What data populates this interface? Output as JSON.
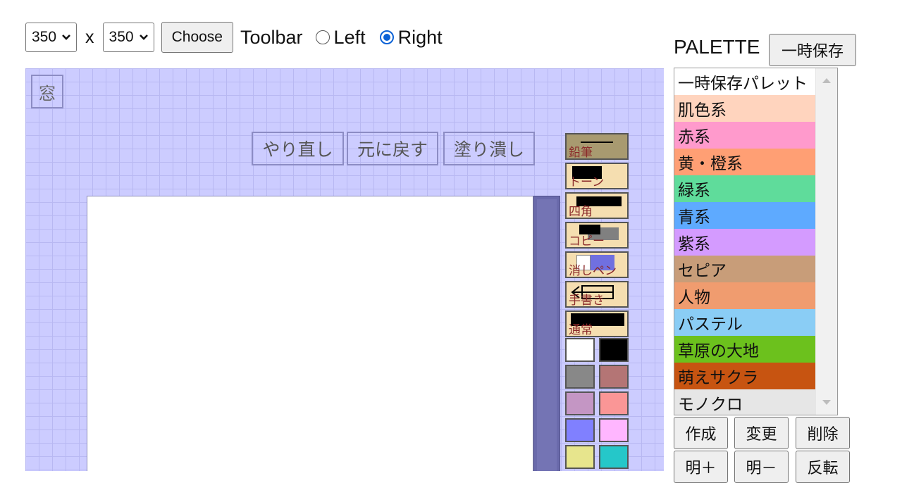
{
  "size_controls": {
    "width_value": "350",
    "x_label": "x",
    "height_value": "350",
    "choose_label": "Choose"
  },
  "toolbar_position": {
    "label": "Toolbar",
    "options": [
      {
        "label": "Left",
        "selected": false
      },
      {
        "label": "Right",
        "selected": true
      }
    ]
  },
  "workspace": {
    "window_button": "窓",
    "redo_label": "やり直し",
    "undo_label": "元に戻す",
    "fill_label": "塗り潰し",
    "background_color": "#ccccff"
  },
  "tools": [
    {
      "label": "鉛筆",
      "active": true,
      "icon": "pencil-icon"
    },
    {
      "label": "トーン",
      "active": false,
      "icon": "tone-icon"
    },
    {
      "label": "四角",
      "active": false,
      "icon": "rectangle-icon"
    },
    {
      "label": "コピー",
      "active": false,
      "icon": "copy-icon"
    },
    {
      "label": "消しペン",
      "active": false,
      "icon": "eraser-icon"
    },
    {
      "label": "手書き",
      "active": false,
      "icon": "freehand-icon"
    },
    {
      "label": "通常",
      "active": false,
      "icon": "normal-icon"
    }
  ],
  "swatch_colors": [
    "#ffffff",
    "#000000",
    "#888888",
    "#b47575",
    "#c496c4",
    "#fa9696",
    "#8080ff",
    "#ffb6ff",
    "#e7e58d",
    "#25c7c9"
  ],
  "palette": {
    "title": "PALETTE",
    "save_label": "一時保存",
    "items": [
      {
        "label": "一時保存パレット",
        "color": "#ffffff"
      },
      {
        "label": "肌色系",
        "color": "#ffd4be"
      },
      {
        "label": "赤系",
        "color": "#ff9acc"
      },
      {
        "label": "黄・橙系",
        "color": "#ff9f74"
      },
      {
        "label": "緑系",
        "color": "#5fdc9b"
      },
      {
        "label": "青系",
        "color": "#5eaaff"
      },
      {
        "label": "紫系",
        "color": "#d49bff"
      },
      {
        "label": "セピア",
        "color": "#c89d79"
      },
      {
        "label": "人物",
        "color": "#f09c6f"
      },
      {
        "label": "パステル",
        "color": "#8acdf5"
      },
      {
        "label": "草原の大地",
        "color": "#6cc11d"
      },
      {
        "label": "萌えサクラ",
        "color": "#c75411"
      },
      {
        "label": "モノクロ",
        "color": "#e6e6e6"
      }
    ],
    "buttons_row1": [
      "作成",
      "変更",
      "削除"
    ],
    "buttons_row2": [
      "明＋",
      "明－",
      "反転"
    ]
  }
}
